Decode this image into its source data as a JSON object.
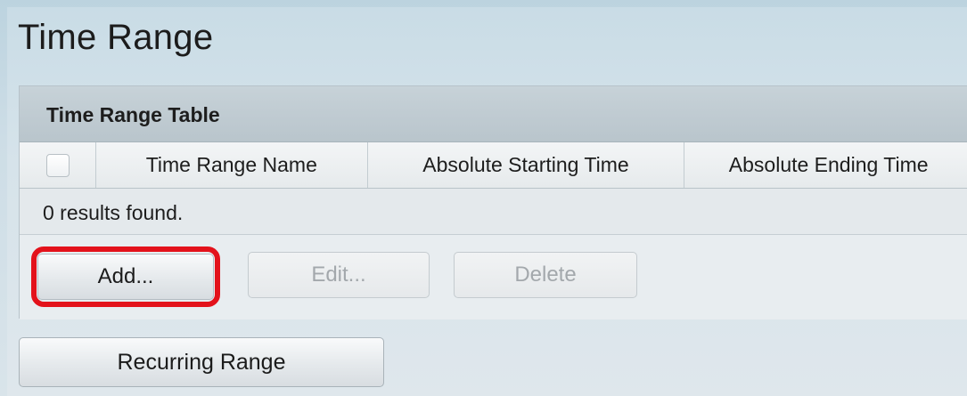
{
  "page": {
    "title": "Time Range"
  },
  "table": {
    "caption": "Time Range Table",
    "columns": [
      "Time Range Name",
      "Absolute Starting Time",
      "Absolute Ending Time"
    ],
    "rows": [],
    "results_text": "0 results found."
  },
  "actions": {
    "add_label": "Add...",
    "edit_label": "Edit...",
    "delete_label": "Delete"
  },
  "recurring": {
    "label": "Recurring Range"
  },
  "colors": {
    "highlight": "#e3121b",
    "caption_bg": "#bfcad0",
    "page_bg": "#cddde6"
  }
}
